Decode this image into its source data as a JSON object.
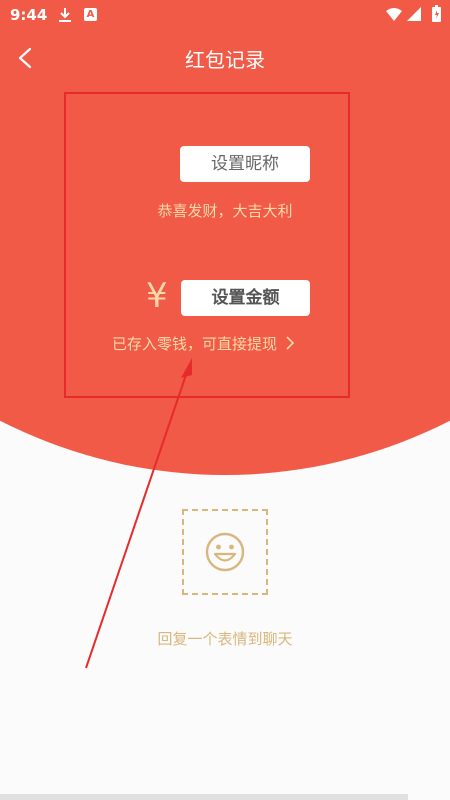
{
  "status_bar": {
    "time": "9:44",
    "icons": [
      "download-icon",
      "a-badge-icon",
      "wifi-icon",
      "signal-icon",
      "battery-icon"
    ],
    "a_badge": "A"
  },
  "nav": {
    "title": "红包记录",
    "back_icon": "chevron-left-icon"
  },
  "red_packet": {
    "nickname_button": "设置昵称",
    "greeting": "恭喜发财，大吉大利",
    "currency_symbol": "¥",
    "amount_button": "设置金额",
    "change_link": "已存入零钱，可直接提现",
    "change_link_icon": "chevron-right-icon"
  },
  "reply": {
    "emoji_icon": "smile-icon",
    "caption": "回复一个表情到聊天"
  },
  "colors": {
    "header_red": "#f05a47",
    "gold_text": "#fbd9a9",
    "dashed_gold": "#d8b77c",
    "annotation_red": "#e72a2a",
    "background": "#fbfbfb"
  }
}
